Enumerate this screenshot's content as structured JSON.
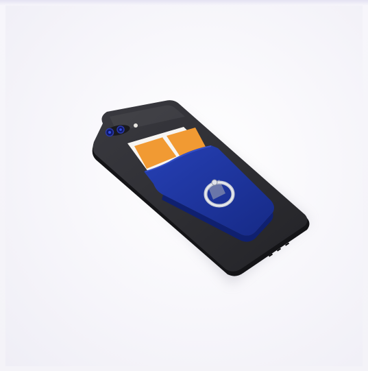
{
  "image": {
    "subject": "phone-with-card-holder-and-ring",
    "colors": {
      "background": "#f6f5fa",
      "frame": "#e4e2f2",
      "phone_body": "#2b2b2f",
      "phone_edge": "#1b1b1e",
      "card_holder": "#1f35a3",
      "card_holder_shade": "#162a86",
      "card_orange": "#f19a33",
      "card_white": "#f7f5f2",
      "ring_metal": "#c9cdd6",
      "camera_lens": "#0f1a6a"
    }
  }
}
